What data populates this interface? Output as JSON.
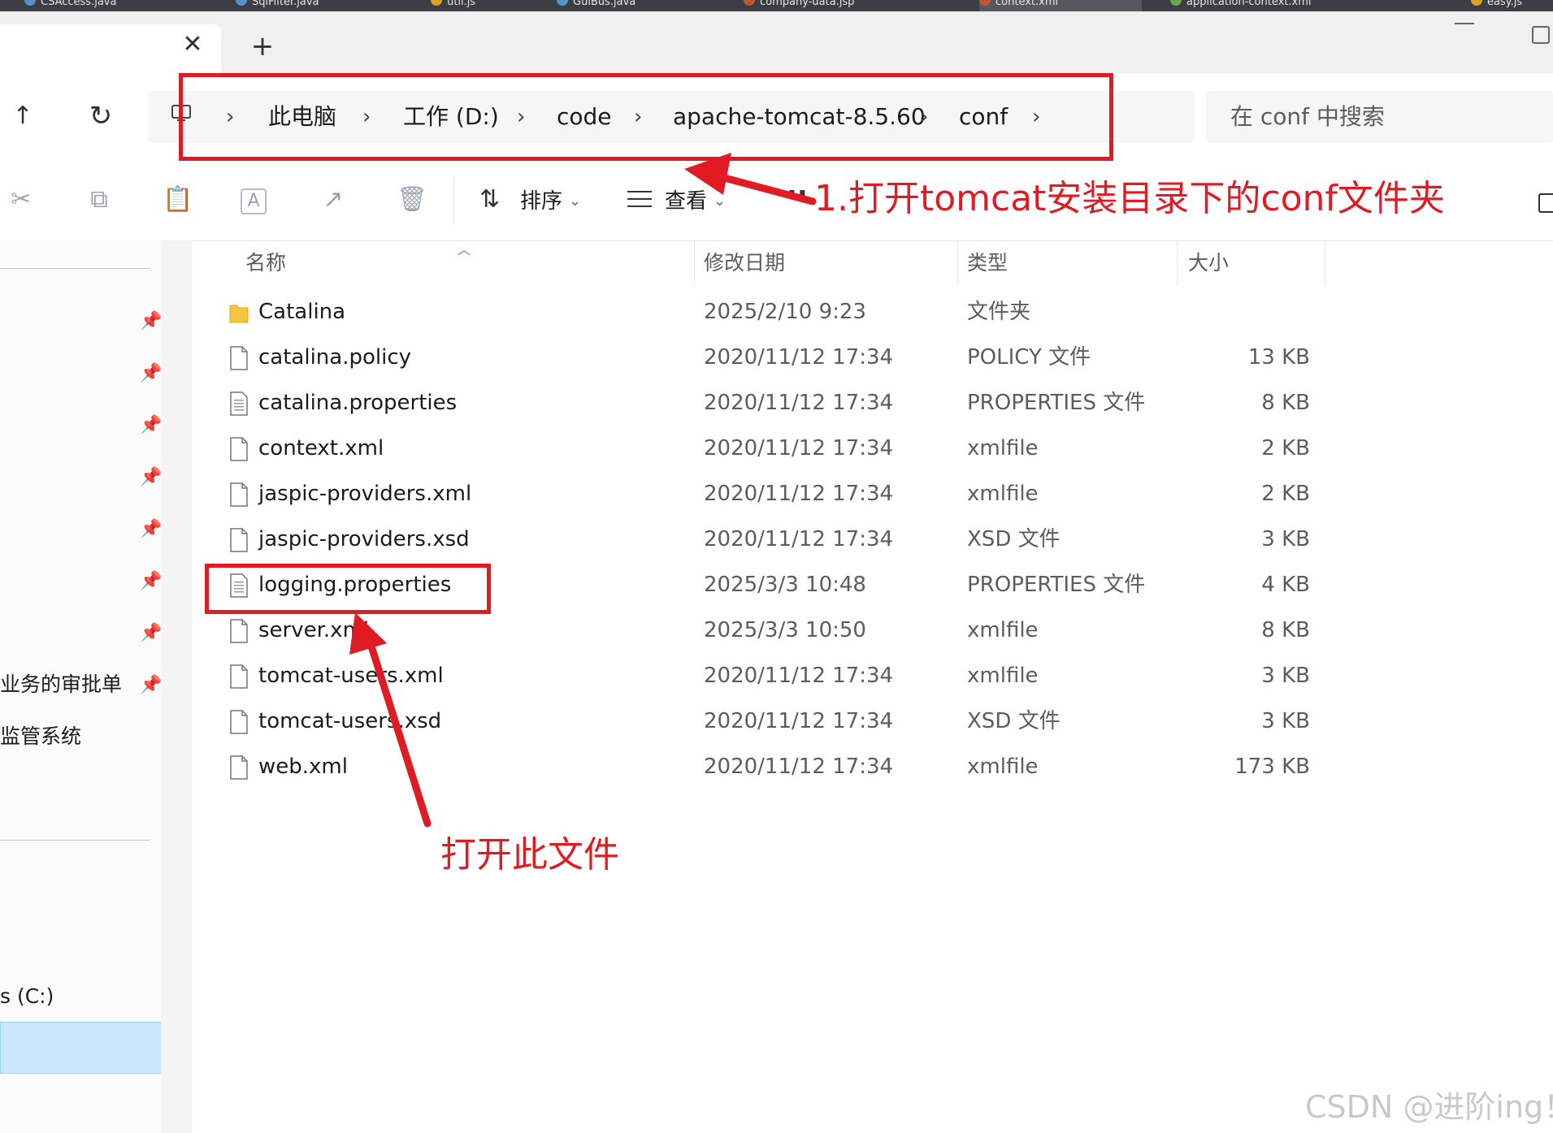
{
  "top_tabs": [
    "CSAccess.java",
    "SqlFilter.java",
    "util.js",
    "GuiBus.java",
    "company-data.jsp",
    "context.xml",
    "application-context.xml",
    "easy.js"
  ],
  "window": {
    "tab_close": "✕",
    "new_tab": "+"
  },
  "nav": {
    "up": "↑",
    "refresh": "↻"
  },
  "breadcrumb": {
    "items": [
      "此电脑",
      "工作 (D:)",
      "code",
      "apache-tomcat-8.5.60",
      "conf"
    ],
    "separator": "›"
  },
  "search": {
    "placeholder": "在 conf 中搜索"
  },
  "toolbar": {
    "cut": "✂",
    "copy": "⧉",
    "paste": "📋",
    "rename": "A",
    "share": "↗",
    "delete": "🗑",
    "sort_label": "排序",
    "view_label": "查看",
    "more": "···",
    "chevron": "⌄"
  },
  "sidebar": {
    "labels": [
      "业务的审批单",
      "监管系统",
      "s (C:)"
    ]
  },
  "columns": {
    "name": "名称",
    "date": "修改日期",
    "type": "类型",
    "size": "大小"
  },
  "files": [
    {
      "name": "Catalina",
      "date": "2025/2/10 9:23",
      "type": "文件夹",
      "size": "",
      "icon": "folder-icon"
    },
    {
      "name": "catalina.policy",
      "date": "2020/11/12 17:34",
      "type": "POLICY 文件",
      "size": "13 KB",
      "icon": "file-icon"
    },
    {
      "name": "catalina.properties",
      "date": "2020/11/12 17:34",
      "type": "PROPERTIES 文件",
      "size": "8 KB",
      "icon": "text-file-icon"
    },
    {
      "name": "context.xml",
      "date": "2020/11/12 17:34",
      "type": "xmlfile",
      "size": "2 KB",
      "icon": "file-icon"
    },
    {
      "name": "jaspic-providers.xml",
      "date": "2020/11/12 17:34",
      "type": "xmlfile",
      "size": "2 KB",
      "icon": "file-icon"
    },
    {
      "name": "jaspic-providers.xsd",
      "date": "2020/11/12 17:34",
      "type": "XSD 文件",
      "size": "3 KB",
      "icon": "file-icon"
    },
    {
      "name": "logging.properties",
      "date": "2025/3/3 10:48",
      "type": "PROPERTIES 文件",
      "size": "4 KB",
      "icon": "text-file-icon"
    },
    {
      "name": "server.xml",
      "date": "2025/3/3 10:50",
      "type": "xmlfile",
      "size": "8 KB",
      "icon": "file-icon"
    },
    {
      "name": "tomcat-users.xml",
      "date": "2020/11/12 17:34",
      "type": "xmlfile",
      "size": "3 KB",
      "icon": "file-icon"
    },
    {
      "name": "tomcat-users.xsd",
      "date": "2020/11/12 17:34",
      "type": "XSD 文件",
      "size": "3 KB",
      "icon": "file-icon"
    },
    {
      "name": "web.xml",
      "date": "2020/11/12 17:34",
      "type": "xmlfile",
      "size": "173 KB",
      "icon": "file-icon"
    }
  ],
  "annotations": {
    "step1": "1.打开tomcat安装目录下的conf文件夹",
    "step2": "打开此文件",
    "color": "#e01b24"
  },
  "watermark": "CSDN @进阶ing！"
}
